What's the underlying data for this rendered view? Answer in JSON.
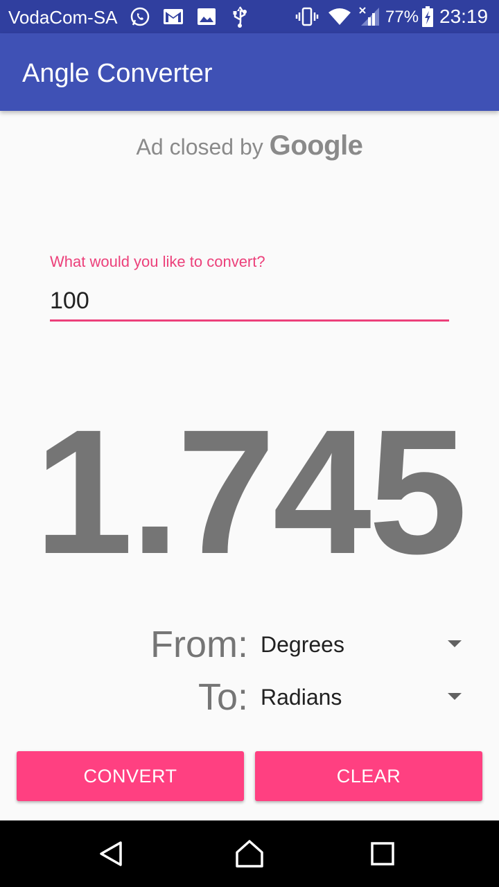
{
  "status_bar": {
    "carrier": "VodaCom-SA",
    "battery": "77%",
    "time": "23:19",
    "icons": [
      "whatsapp-icon",
      "gmail-icon",
      "image-icon",
      "usb-icon",
      "vibrate-icon",
      "wifi-icon",
      "signal-icon",
      "battery-charging-icon"
    ]
  },
  "app_bar": {
    "title": "Angle Converter",
    "color": "#3f51b5"
  },
  "ad": {
    "text": "Ad closed by",
    "brand": "Google"
  },
  "input": {
    "label": "What would you like to convert?",
    "value": "100",
    "accent_color": "#ec407a"
  },
  "result": {
    "value": "1.745"
  },
  "from": {
    "label": "From:",
    "selected": "Degrees"
  },
  "to": {
    "label": "To:",
    "selected": "Radians"
  },
  "buttons": {
    "convert": "CONVERT",
    "clear": "CLEAR",
    "color": "#ff4081"
  },
  "nav_bar": {
    "icons": [
      "back-icon",
      "home-icon",
      "recents-icon"
    ]
  }
}
